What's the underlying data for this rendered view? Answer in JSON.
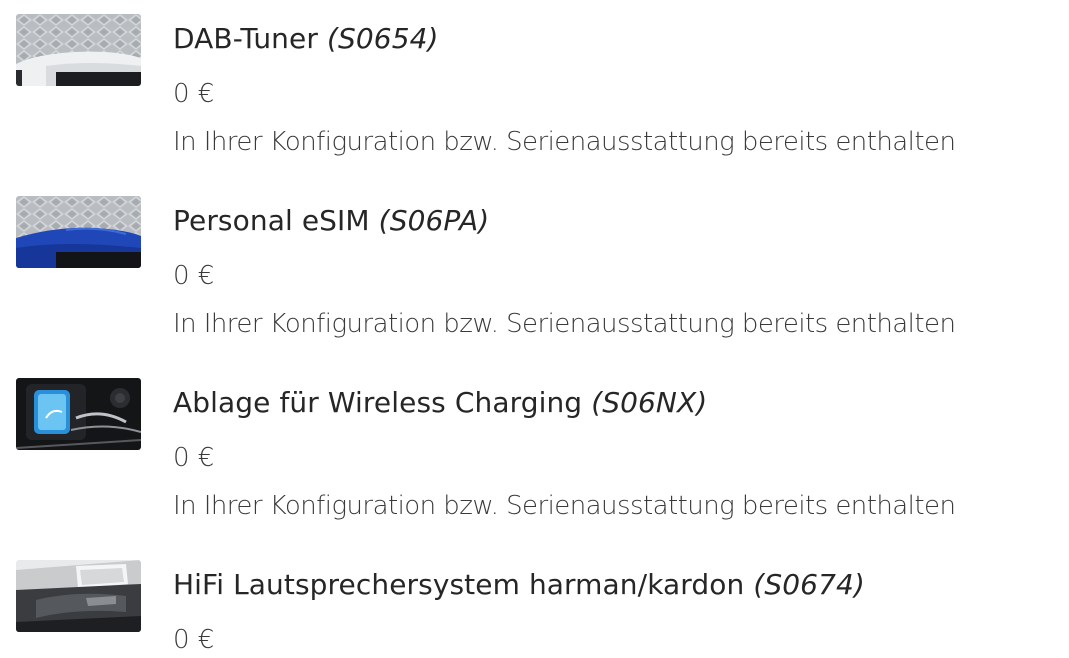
{
  "items": [
    {
      "title": "DAB-Tuner",
      "code": "(S0654)",
      "price": "0 €",
      "note": "In Ihrer Konfiguration bzw. Serienausstattung bereits enthalten",
      "image": "car-roof-white-thumbnail"
    },
    {
      "title": "Personal eSIM",
      "code": "(S06PA)",
      "price": "0 €",
      "note": "In Ihrer Konfiguration bzw. Serienausstattung bereits enthalten",
      "image": "car-roof-blue-thumbnail"
    },
    {
      "title": "Ablage für Wireless Charging",
      "code": "(S06NX)",
      "price": "0 €",
      "note": "In Ihrer Konfiguration bzw. Serienausstattung bereits enthalten",
      "image": "wireless-charging-tray-thumbnail"
    },
    {
      "title": "HiFi Lautsprechersystem harman/kardon",
      "code": "(S0674)",
      "price": "0 €",
      "image": "door-speaker-interior-thumbnail"
    }
  ]
}
